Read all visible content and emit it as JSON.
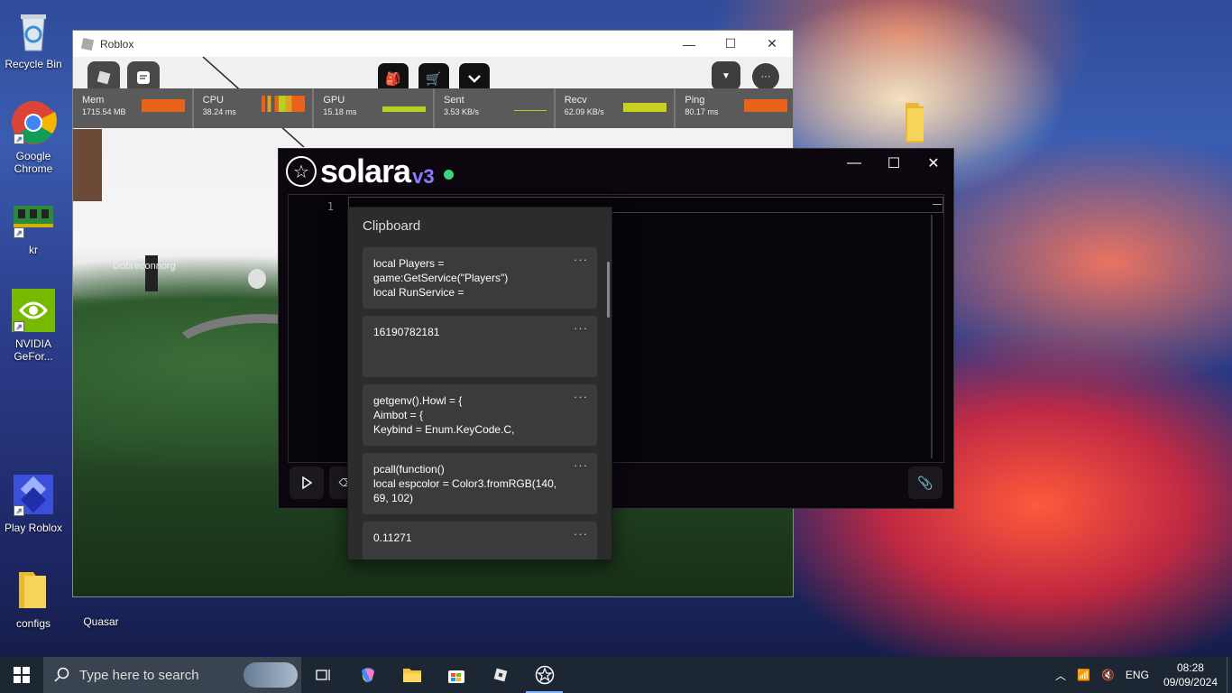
{
  "desktop": {
    "icons": [
      {
        "label": "Recycle Bin"
      },
      {
        "label": "Google Chrome"
      },
      {
        "label": "kr"
      },
      {
        "label": "NVIDIA GeFor..."
      },
      {
        "label": "Play Roblox"
      },
      {
        "label": "configs"
      },
      {
        "label": "Quasar"
      }
    ]
  },
  "roblox": {
    "title": "Roblox",
    "player_name": "Dobreconnorg",
    "stats": [
      {
        "label": "Mem",
        "value": "1715.54 MB",
        "color": "#e8621a"
      },
      {
        "label": "CPU",
        "value": "38.24 ms",
        "color": "#e0a020"
      },
      {
        "label": "GPU",
        "value": "15.18 ms",
        "color": "#b8d020"
      },
      {
        "label": "Sent",
        "value": "3.53 KB/s",
        "color": "#b8d020"
      },
      {
        "label": "Recv",
        "value": "62.09 KB/s",
        "color": "#c8d020"
      },
      {
        "label": "Ping",
        "value": "80.17 ms",
        "color": "#e8621a"
      }
    ]
  },
  "solara": {
    "name": "solara",
    "version": "v3",
    "line_number": "1",
    "status_color": "#3bd67a"
  },
  "clipboard": {
    "title": "Clipboard",
    "more_label": "···",
    "items": [
      {
        "text": "local Players =\ngame:GetService(\"Players\")\nlocal RunService ="
      },
      {
        "text": "16190782181"
      },
      {
        "text": "getgenv().Howl = {\nAimbot = {\nKeybind = Enum.KeyCode.C,"
      },
      {
        "text": "pcall(function()\nlocal espcolor = Color3.fromRGB(140,\n69, 102)"
      },
      {
        "text": "0.11271"
      }
    ]
  },
  "taskbar": {
    "search_placeholder": "Type here to search",
    "language": "ENG",
    "time": "08:28",
    "date": "09/09/2024"
  }
}
